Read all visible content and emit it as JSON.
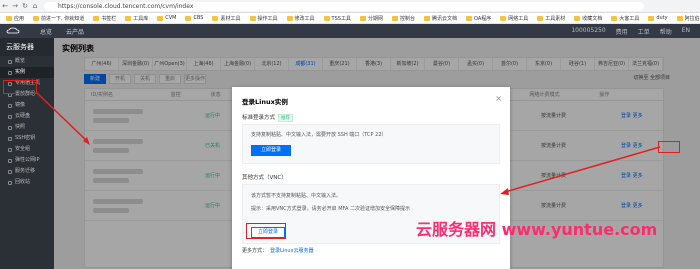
{
  "browser": {
    "url": "https://console.cloud.tencent.com/cvm/index",
    "bookmarks": [
      "应用",
      "前进一下, 你就知道",
      "书签栏",
      "工具库",
      "CVM",
      "CBS",
      "素材工具",
      "操作工具",
      "修改工具",
      "TSS工具",
      "分期网",
      "控制台",
      "腾讯云文档",
      "OA程序",
      "网络工具",
      "工具素材",
      "收藏文档",
      "大客工具",
      "duty",
      "阿拉伯工具"
    ]
  },
  "topnav": {
    "items": [
      "总览",
      "云产品"
    ],
    "right": [
      "100005250",
      "费用",
      "工单",
      "帮助",
      "EN"
    ]
  },
  "sidebar": {
    "title": "云服务器",
    "items": [
      "概览",
      "实例",
      "专用宿主机",
      "置放群组",
      "镜像",
      "云硬盘",
      "快照",
      "SSH密钥",
      "安全组",
      "弹性公网IP",
      "服务迁移",
      "回收站"
    ],
    "active_index": 1
  },
  "main": {
    "title": "实例列表",
    "tabs": [
      "广州(46)",
      "深圳金融(0)",
      "广州Open(3)",
      "上海(46)",
      "上海金融(0)",
      "北京(12)",
      "成都(31)",
      "重庆(21)",
      "香港(3)",
      "新加坡(2)",
      "曼谷(0)",
      "孟买(0)",
      "首尔(0)",
      "东京(0)",
      "硅谷(1)",
      "弗吉尼亚(0)",
      "法兰克福(0)"
    ],
    "active_tab": 6,
    "toolbar": [
      "新建",
      "开机",
      "关机",
      "重启",
      "更多操作"
    ],
    "toolbar_right": "切换至 全部项目",
    "table_headers": [
      "ID/实例名",
      "监控",
      "状态",
      "可用区",
      "主机类型",
      "配置",
      "主IP地址",
      "实例计费模式",
      "网络计费模式",
      "操作"
    ],
    "rows": [
      {
        "status": "运行中",
        "billing": "按流量计费",
        "action": "登录",
        "more": "更多"
      },
      {
        "status": "已关机",
        "billing": "按流量计费",
        "action": "登录",
        "more": "更多"
      },
      {
        "status": "运行中",
        "billing": "按流量计费",
        "action": "登录",
        "more": "更多"
      },
      {
        "status": "运行中",
        "billing": "按流量计费",
        "action": "登录",
        "more": "更多"
      }
    ]
  },
  "modal": {
    "title": "登录Linux实例",
    "close": "×",
    "standard_label": "标准登录方式",
    "recommended_tag": "推荐",
    "standard_desc": "支持复制粘贴、中文输入法，需要开放 SSH 端口（TCP 22）",
    "standard_button": "立即登录",
    "other_label": "其他方式（VNC）",
    "other_desc1": "该方式暂不支持复制粘贴、中文输入法。",
    "other_desc2": "提示：采用VNC方式登录，请务必开启 MFA 二次验证增加安全保障提示",
    "vnc_button": "立即登录",
    "more_label": "更多方式：",
    "more_link": "登录Linux云服务器"
  },
  "watermark": "云服务器网 www.yuntue.com"
}
